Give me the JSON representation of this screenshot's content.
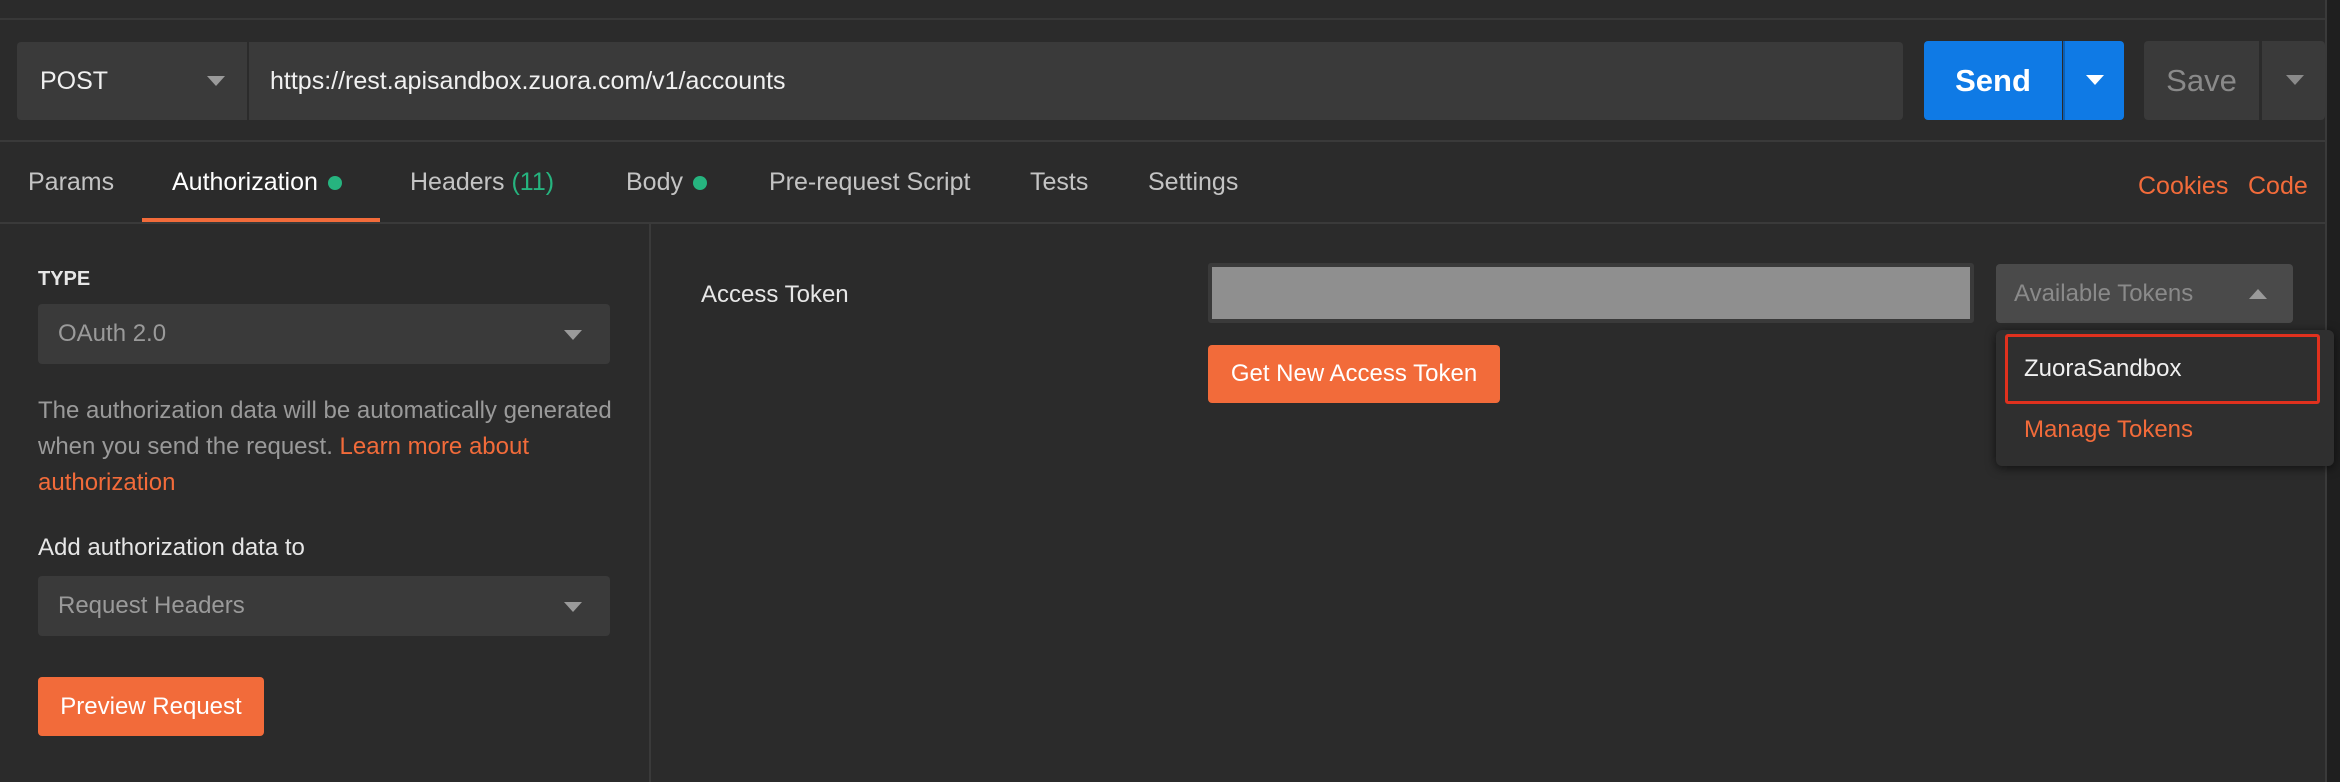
{
  "request": {
    "method": "POST",
    "url": "https://rest.apisandbox.zuora.com/v1/accounts",
    "send_label": "Send",
    "save_label": "Save"
  },
  "tabs": [
    {
      "label": "Params"
    },
    {
      "label": "Authorization",
      "dot": true
    },
    {
      "label": "Headers",
      "count": "(11)"
    },
    {
      "label": "Body",
      "dot": true
    },
    {
      "label": "Pre-request Script"
    },
    {
      "label": "Tests"
    },
    {
      "label": "Settings"
    }
  ],
  "active_tab": "Authorization",
  "right_links": {
    "cookies": "Cookies",
    "code": "Code"
  },
  "auth": {
    "type_label": "TYPE",
    "type_value": "OAuth 2.0",
    "description": "The authorization data will be automatically generated when you send the request. ",
    "learn_more": "Learn more about authorization",
    "add_to_label": "Add authorization data to",
    "add_to_value": "Request Headers",
    "preview_button": "Preview Request"
  },
  "token": {
    "label": "Access Token",
    "value": "",
    "get_new_button": "Get New Access Token",
    "available_label": "Available Tokens",
    "dropdown_items": [
      "ZuoraSandbox",
      "Manage Tokens"
    ]
  },
  "colors": {
    "accent_orange": "#f26b3a",
    "send_blue": "#0f7ae5",
    "status_green": "#26b47f",
    "highlight_red": "#e0311e",
    "background": "#2b2b2b"
  }
}
